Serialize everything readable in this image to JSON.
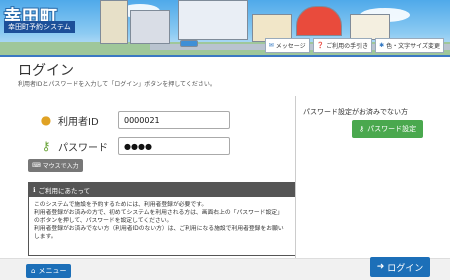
{
  "header": {
    "site_title": "幸田町",
    "site_subtitle": "幸田町予約システム",
    "links": [
      {
        "icon": "message-icon",
        "label": "メッセージ"
      },
      {
        "icon": "help-book-icon",
        "label": "ご利用の手引き"
      },
      {
        "icon": "text-size-icon",
        "label": "色・文字サイズ変更"
      }
    ]
  },
  "page": {
    "title": "ログイン",
    "description": "利用者IDとパスワードを入力して「ログイン」ボタンを押してください。"
  },
  "form": {
    "user_id_label": "利用者ID",
    "user_id_value": "0000021",
    "password_label": "パスワード",
    "password_value": "●●●●",
    "mouse_input_label": "マウスで入力"
  },
  "notice": {
    "heading": "ご利用にあたって",
    "lines": [
      "このシステムで施設を予約するためには、利用者登録が必要です。",
      "利用者登録がお済みの方で、初めてシステムを利用される方は、画面右上の「パスワード設定」",
      "のボタンを押して、パスワードを設定してください。",
      "利用者登録がお済みでない方（利用者IDのない方）は、ご利用になる施設で利用者登録をお願い",
      "します。"
    ]
  },
  "right": {
    "title": "パスワード設定がお済みでない方",
    "password_button": "パスワード設定"
  },
  "footer": {
    "menu_button": "メニュー",
    "login_button": "ログイン"
  },
  "colors": {
    "primary": "#1c6fb8",
    "green": "#4aa84e",
    "header_sky": "#4fa9ea"
  }
}
